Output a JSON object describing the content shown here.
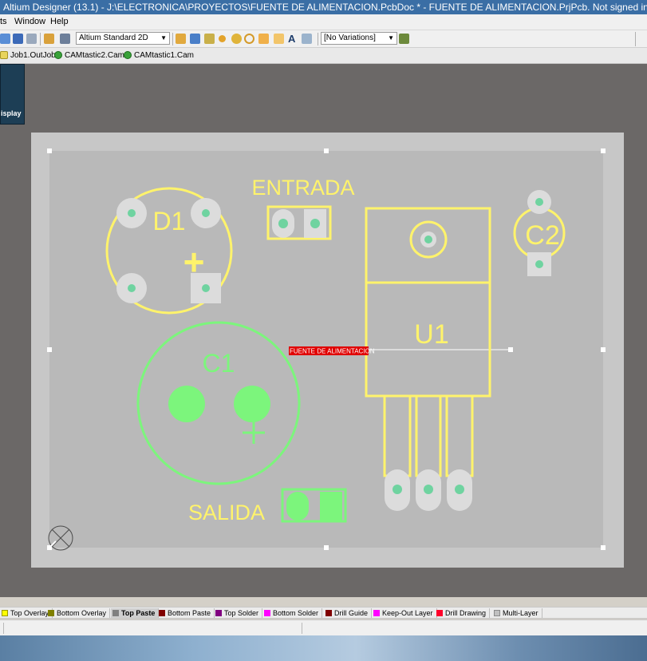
{
  "window": {
    "title": "Altium Designer (13.1) - J:\\ELECTRONICA\\PROYECTOS\\FUENTE DE ALIMENTACION.PcbDoc * - FUENTE DE ALIMENTACION.PrjPcb. Not signed in."
  },
  "menu": {
    "items": [
      "ts",
      "Window",
      "Help"
    ]
  },
  "toolbar": {
    "view_config": "Altium Standard 2D",
    "variations": "[No Variations]"
  },
  "documents": {
    "tabs": [
      "Job1.OutJob",
      "CAMtastic2.Cam",
      "CAMtastic1.Cam"
    ]
  },
  "panel": {
    "display_label": "isplay"
  },
  "pcb": {
    "labels": {
      "entrada": "ENTRADA",
      "salida": "SALIDA",
      "d1": "D1",
      "c1": "C1",
      "c2": "C2",
      "u1": "U1",
      "plus": "+"
    },
    "selection_tag": "FUENTE DE ALIMENTACION",
    "colors": {
      "overlay_yellow": "#fff36b",
      "overlay_green": "#7cf57c",
      "pad_gray": "#dcdcdc",
      "pad_center": "#6fd3a0",
      "board": "#b9b9b9",
      "outline": "#c7c7c7",
      "selection_red": "#e00000"
    }
  },
  "layers": {
    "tabs": [
      {
        "label": "Top Overlay",
        "color": "#ffff00"
      },
      {
        "label": "Bottom Overlay",
        "color": "#808000"
      },
      {
        "label": "Top Paste",
        "color": "#808080"
      },
      {
        "label": "Bottom Paste",
        "color": "#800000"
      },
      {
        "label": "Top Solder",
        "color": "#800080"
      },
      {
        "label": "Bottom Solder",
        "color": "#ff00ff"
      },
      {
        "label": "Drill Guide",
        "color": "#800000"
      },
      {
        "label": "Keep-Out Layer",
        "color": "#ff00ff"
      },
      {
        "label": "Drill Drawing",
        "color": "#ff002a"
      },
      {
        "label": "Multi-Layer",
        "color": "#c0c0c0"
      }
    ],
    "active": "Top Paste"
  }
}
